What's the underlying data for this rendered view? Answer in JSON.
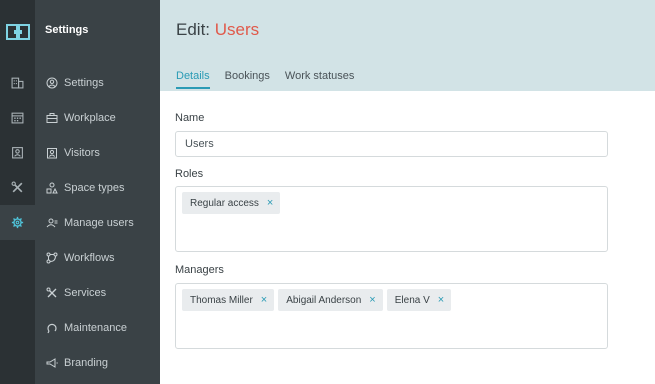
{
  "app": {
    "logo_icon": "logo-icon",
    "section_title": "Settings"
  },
  "rail": {
    "icons": [
      "building-icon",
      "calendar-icon",
      "badge-icon",
      "tools-icon",
      "gear-icon"
    ],
    "active": "gear-icon"
  },
  "sidebar": {
    "items": [
      {
        "label": "Settings",
        "icon": "user-circle-icon"
      },
      {
        "label": "Workplace",
        "icon": "briefcase-icon"
      },
      {
        "label": "Visitors",
        "icon": "visitor-badge-icon"
      },
      {
        "label": "Space types",
        "icon": "shapes-icon"
      },
      {
        "label": "Manage users",
        "icon": "users-icon"
      },
      {
        "label": "Workflows",
        "icon": "workflow-icon"
      },
      {
        "label": "Services",
        "icon": "wrench-icon"
      },
      {
        "label": "Maintenance",
        "icon": "maintenance-icon"
      },
      {
        "label": "Branding",
        "icon": "megaphone-icon"
      }
    ]
  },
  "header": {
    "title_prefix": "Edit: ",
    "title_name": "Users",
    "tabs": [
      {
        "label": "Details",
        "active": true
      },
      {
        "label": "Bookings",
        "active": false
      },
      {
        "label": "Work statuses",
        "active": false
      }
    ]
  },
  "form": {
    "name_label": "Name",
    "name_value": "Users",
    "roles_label": "Roles",
    "roles": [
      "Regular access"
    ],
    "managers_label": "Managers",
    "managers": [
      "Thomas Miller",
      "Abigail Anderson",
      "Elena V"
    ],
    "remove_glyph": "×"
  },
  "colors": {
    "rail_bg": "#2b3134",
    "sidebar_bg": "#3a4246",
    "header_bg": "#d2e3e6",
    "accent": "#2a9bb5",
    "title_accent": "#e05a4b"
  }
}
